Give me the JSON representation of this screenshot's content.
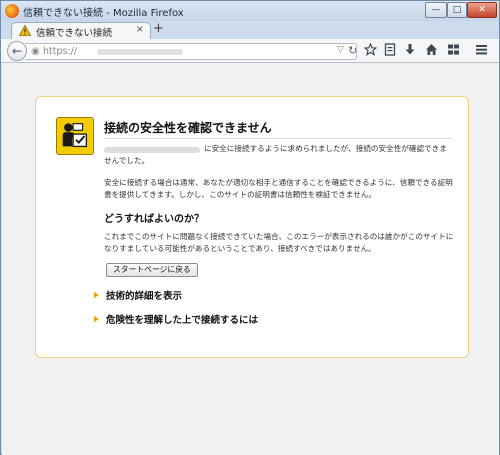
{
  "window": {
    "title": "信頼できない接続 - Mozilla Firefox",
    "min_label": "—",
    "max_label": "□",
    "close_label": "✕"
  },
  "tabs": [
    {
      "label": "信頼できない接続",
      "close": "×"
    }
  ],
  "newtab_label": "+",
  "urlbar": {
    "scheme": "https://",
    "dropdown": "▽",
    "reload": "↻"
  },
  "toolbar_icons": [
    "star-icon",
    "reading-list-icon",
    "download-icon",
    "home-icon",
    "sync-icon",
    "menu-icon"
  ],
  "error": {
    "title": "接続の安全性を確認できません",
    "p1_suffix": "に安全に接続するように求められましたが、接続の安全性が確認できま",
    "p1_cont": "せんでした。",
    "p2": "安全に接続する場合は通常、あなたが適切な相手と通信することを確認できるように、信頼できる証明書を提供してきます。しかし、このサイトの証明書は信頼性を検証できません。",
    "heading": "どうすればよいのか？",
    "p3": "これまでこのサイトに問題なく接続できていた場合、このエラーが表示されるのは誰かがこのサイトになりすましている可能性があるということであり、接続すべきではありません。",
    "back_button": "スタートページに戻る",
    "expander1": "技術的詳細を表示",
    "expander2": "危険性を理解した上で接続するには"
  },
  "colors": {
    "accent_yellow": "#f0d27a",
    "arrow": "#e6a100"
  }
}
